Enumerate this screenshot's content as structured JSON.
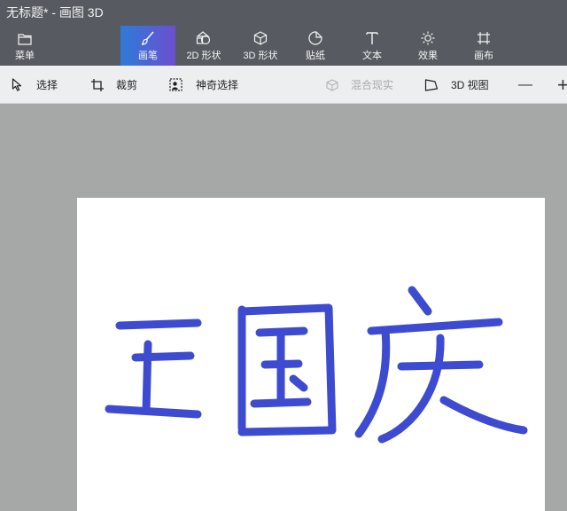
{
  "window": {
    "title": "无标题* - 画图 3D"
  },
  "ribbon": {
    "menu_label": "菜单",
    "tabs": [
      {
        "label": "画笔",
        "active": true
      },
      {
        "label": "2D 形状"
      },
      {
        "label": "3D 形状"
      },
      {
        "label": "贴纸"
      },
      {
        "label": "文本"
      },
      {
        "label": "效果"
      },
      {
        "label": "画布"
      }
    ],
    "active_gradient": [
      "#2f7bd6",
      "#6b4fd1"
    ]
  },
  "toolbar": {
    "select_label": "选择",
    "crop_label": "裁剪",
    "magic_select_label": "神奇选择",
    "mixed_reality_label": "混合现实",
    "view3d_label": "3D 视图",
    "zoom_out_label": "—",
    "zoom_in_label": "+"
  },
  "canvas": {
    "background": "#ffffff",
    "ink_color": "#3d4bd1",
    "handwriting": "王国庆"
  }
}
